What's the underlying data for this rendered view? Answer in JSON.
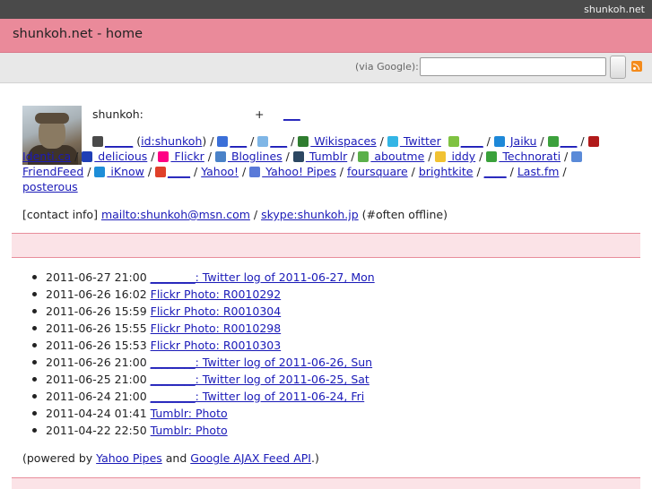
{
  "topbar": {
    "site": "shunkoh.net"
  },
  "header": {
    "title": "shunkoh.net - home"
  },
  "search": {
    "via_label": "(via Google):",
    "input_value": "",
    "rss_icon": "rss-feed-icon"
  },
  "profile": {
    "name": "shunkoh:",
    "plus": "+",
    "blank_link": "___"
  },
  "links": [
    {
      "icon": "hatena-diary-icon",
      "color": "#4a4a4a",
      "text": "_____"
    },
    {
      "sep": " ("
    },
    {
      "text": "id:shunkoh",
      "noicon": true
    },
    {
      "sep": ") / "
    },
    {
      "icon": "google-icon",
      "color": "#3b6fd8",
      "text": "___"
    },
    {
      "sep": " / "
    },
    {
      "icon": "bird-icon",
      "color": "#7fb6e6",
      "text": "___"
    },
    {
      "sep": " / "
    },
    {
      "icon": "wikispaces-icon",
      "color": "#2f7d2f",
      "text": " Wikispaces"
    },
    {
      "sep": " / "
    },
    {
      "icon": "twitter-icon",
      "color": "#33b5e5",
      "text": " Twitter"
    },
    {
      "sep": "  "
    },
    {
      "icon": "friendfeed-f-icon",
      "color": "#7fc241",
      "text": "____"
    },
    {
      "sep": " / "
    },
    {
      "icon": "jaiku-icon",
      "color": "#1e88d8",
      "text": " Jaiku"
    },
    {
      "sep": " / "
    },
    {
      "icon": "wassr-icon",
      "color": "#3ca13c",
      "text": "___"
    },
    {
      "sep": " / "
    },
    {
      "icon": "q-icon",
      "color": "#b11a1a",
      "text": ""
    },
    {
      "break": true
    },
    {
      "text": "Identi.ca",
      "noicon": true
    },
    {
      "sep": " / "
    },
    {
      "icon": "delicious-icon",
      "color": "#1f3fb6",
      "text": " delicious"
    },
    {
      "sep": " / "
    },
    {
      "icon": "flickr-icon",
      "color": "#ff0084",
      "text": " Flickr"
    },
    {
      "sep": " / "
    },
    {
      "icon": "bloglines-icon",
      "color": "#4a82c8",
      "text": " Bloglines"
    },
    {
      "sep": " / "
    },
    {
      "icon": "tumblr-icon",
      "color": "#2c4762",
      "text": " Tumblr"
    },
    {
      "sep": " / "
    },
    {
      "icon": "aboutme-icon",
      "color": "#5bb04a",
      "text": " aboutme"
    },
    {
      "sep": " / "
    },
    {
      "icon": "iddy-icon",
      "color": "#f1c232",
      "text": " iddy"
    },
    {
      "sep": " / "
    },
    {
      "icon": "technorati-icon",
      "color": "#3aa13a",
      "text": " Technorati"
    },
    {
      "sep": " / "
    },
    {
      "icon": "grid-icon",
      "color": "#5a8ad8",
      "text": ""
    },
    {
      "break": true
    },
    {
      "text": "FriendFeed",
      "noicon": true
    },
    {
      "sep": " / "
    },
    {
      "icon": "iknow-icon",
      "color": "#1e8ed8",
      "text": " iKnow"
    },
    {
      "sep": " / "
    },
    {
      "icon": "m-icon",
      "color": "#e0402a",
      "text": "____"
    },
    {
      "sep": " / "
    },
    {
      "text": "Yahoo!",
      "noicon": true
    },
    {
      "sep": " / "
    },
    {
      "icon": "yahoo-pipes-icon",
      "color": "#5a7ad8",
      "text": " Yahoo! Pipes"
    },
    {
      "sep": " / "
    },
    {
      "text": "foursquare",
      "noicon": true
    },
    {
      "sep": " / "
    },
    {
      "text": "brightkite",
      "noicon": true
    },
    {
      "sep": " / "
    },
    {
      "text": "____",
      "noicon": true
    },
    {
      "sep": " / "
    },
    {
      "text": "Last.fm",
      "noicon": true
    },
    {
      "sep": " /"
    },
    {
      "break": true
    },
    {
      "text": "posterous",
      "noicon": true
    }
  ],
  "contact": {
    "label": "[contact info]",
    "mail": "mailto:shunkoh@msn.com",
    "sep": " / ",
    "skype": "skype:shunkoh.jp",
    "note": " (#often offline)"
  },
  "feed": [
    {
      "date": "2011-06-27 21:00",
      "link": "________: Twitter log of 2011-06-27, Mon"
    },
    {
      "date": "2011-06-26 16:02",
      "link": "Flickr Photo: R0010292"
    },
    {
      "date": "2011-06-26 15:59",
      "link": "Flickr Photo: R0010304"
    },
    {
      "date": "2011-06-26 15:55",
      "link": "Flickr Photo: R0010298"
    },
    {
      "date": "2011-06-26 15:53",
      "link": "Flickr Photo: R0010303"
    },
    {
      "date": "2011-06-26 21:00",
      "link": "________: Twitter log of 2011-06-26, Sun"
    },
    {
      "date": "2011-06-25 21:00",
      "link": "________: Twitter log of 2011-06-25, Sat"
    },
    {
      "date": "2011-06-24 21:00",
      "link": "________: Twitter log of 2011-06-24, Fri"
    },
    {
      "date": "2011-04-24 01:41",
      "link": "Tumblr: Photo"
    },
    {
      "date": "2011-04-22 22:50",
      "link": "Tumblr: Photo"
    }
  ],
  "powered": {
    "prefix": "(powered by ",
    "pipes": "Yahoo Pipes",
    "and": " and ",
    "ajax": "Google AJAX Feed API",
    "suffix": ".)"
  }
}
